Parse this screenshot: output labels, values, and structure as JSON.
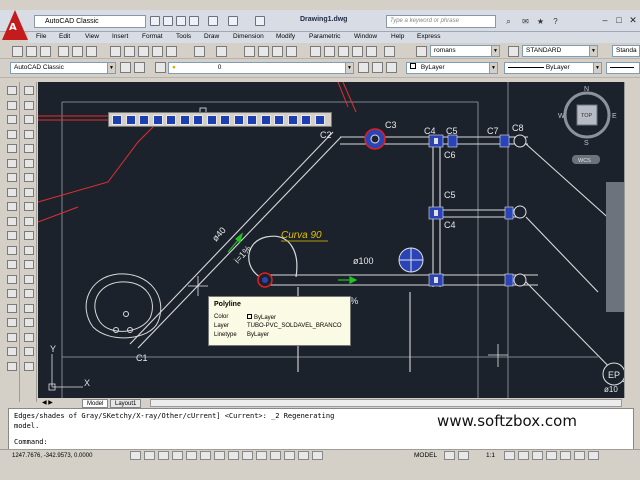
{
  "window": {
    "workspace": "AutoCAD Classic",
    "title": "Drawing1.dwg",
    "search_placeholder": "Type a keyword or phrase"
  },
  "menu": [
    "File",
    "Edit",
    "View",
    "Insert",
    "Format",
    "Tools",
    "Draw",
    "Dimension",
    "Modify",
    "Parametric",
    "Window",
    "Help",
    "Express"
  ],
  "toolbar": {
    "text_style": "romans",
    "dim_style": "STANDARD",
    "table_style": "Standa",
    "workspace_combo": "AutoCAD Classic",
    "layer_value": "0",
    "color_value": "ByLayer",
    "linetype_value": "ByLayer"
  },
  "drawing": {
    "labels": [
      "C1",
      "C2",
      "C3",
      "C4",
      "C5",
      "C6",
      "C7",
      "C8",
      "C5",
      "C4",
      "EP"
    ],
    "dim_40": "ø40",
    "dim_100": "ø100",
    "curva": "Curva 90",
    "slope_1": "i=1%",
    "slope_2": "i=1%",
    "ep_sub": "ø10",
    "viewcube": {
      "top": "TOP",
      "n": "N",
      "s": "S",
      "e": "E",
      "w": "W",
      "wcs": "WCS"
    },
    "ucs_x": "X",
    "ucs_y": "Y"
  },
  "tooltip": {
    "title": "Polyline",
    "rows": [
      {
        "key": "Color",
        "value": "ByLayer"
      },
      {
        "key": "Layer",
        "value": "TUBO-PVC_SOLDAVEL_BRANCO"
      },
      {
        "key": "Linetype",
        "value": "ByLayer"
      }
    ]
  },
  "tabs": [
    "Model",
    "Layout1"
  ],
  "command": {
    "line1": "Edges/shades of Gray/SKetchy/X-ray/Other/cUrrent] <Current>: _2 Regenerating",
    "line2": "model.",
    "prompt": "Command:"
  },
  "watermark": "www.softzbox.com",
  "status": {
    "coords": "1247.7676, -342.9573, 0.0000",
    "model": "MODEL",
    "scale": "1:1"
  }
}
